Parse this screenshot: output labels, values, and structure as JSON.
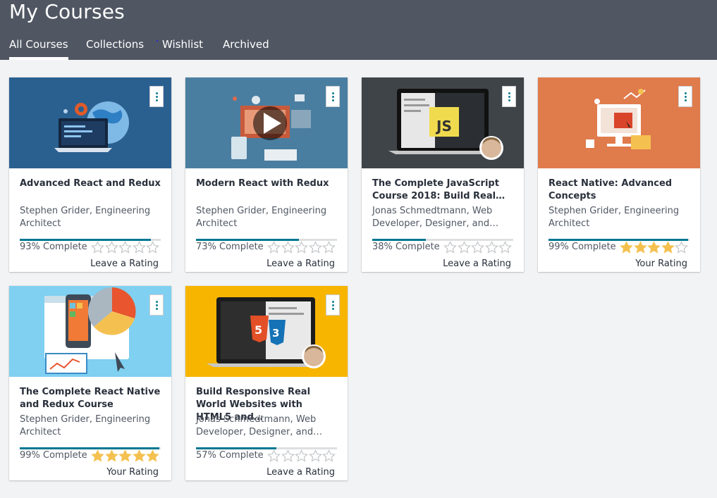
{
  "header": {
    "title": "My Courses",
    "tabs": [
      "All Courses",
      "Collections",
      "Wishlist",
      "Archived"
    ],
    "active_tab": "All Courses"
  },
  "colors": {
    "header_bg": "#505763",
    "progress_fill": "#007791",
    "star_filled": "#f4c150",
    "star_empty_outline": "#c0c3c6"
  },
  "courses": [
    {
      "title": "Advanced React and Redux",
      "author": "Stephen Grider, Engineering Architect",
      "percent_label": "93% Complete",
      "progress": 93,
      "rating": 0,
      "rating_label": "Leave a Rating",
      "thumbnail": "developer-laptop-globe-illustration"
    },
    {
      "title": "Modern React with Redux",
      "author": "Stephen Grider, Engineering Architect",
      "percent_label": "73% Complete",
      "progress": 73,
      "rating": 0,
      "rating_label": "Leave a Rating",
      "thumbnail": "devices-illustration-with-play-icon"
    },
    {
      "title": "The Complete JavaScript Course 2018: Build Real…",
      "author": "Jonas Schmedtmann, Web Developer, Designer, and…",
      "percent_label": "38% Complete",
      "progress": 38,
      "rating": 0,
      "rating_label": "Leave a Rating",
      "thumbnail": "laptop-js-logo-instructor-photo"
    },
    {
      "title": "React Native: Advanced Concepts",
      "author": "Stephen Grider, Engineering Architect",
      "percent_label": "99% Complete",
      "progress": 99,
      "rating": 4,
      "rating_label": "Your Rating",
      "thumbnail": "desktop-monitor-charts-illustration"
    },
    {
      "title": "The Complete React Native and Redux Course",
      "author": "Stephen Grider, Engineering Architect",
      "percent_label": "99% Complete",
      "progress": 99,
      "rating": 5,
      "rating_label": "Your Rating",
      "thumbnail": "mobile-phone-pie-chart-illustration"
    },
    {
      "title": "Build Responsive Real World Websites with HTML5 and…",
      "author": "Jonas Schmedtmann, Web Developer, Designer, and…",
      "percent_label": "57% Complete",
      "progress": 57,
      "rating": 0,
      "rating_label": "Leave a Rating",
      "thumbnail": "laptop-html5-css3-logos-instructor-photo"
    }
  ]
}
